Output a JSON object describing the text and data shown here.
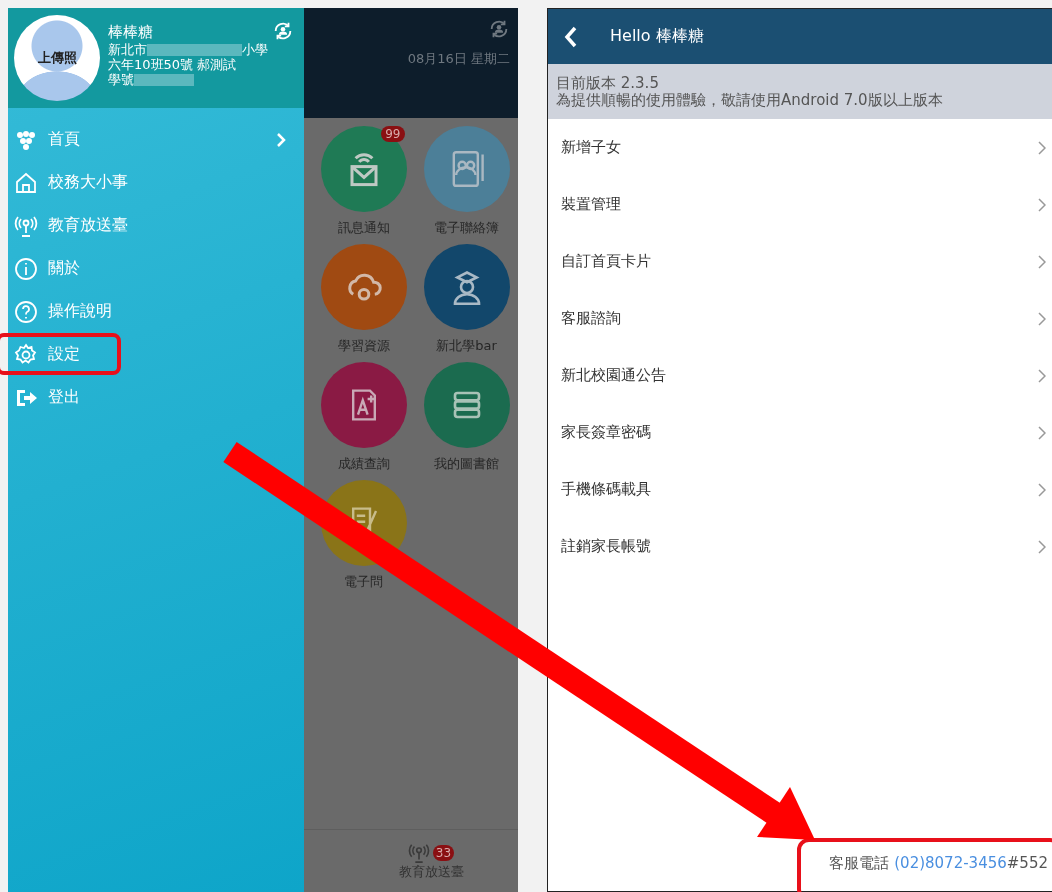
{
  "drawer": {
    "profile": {
      "avatar_text": "上傳照",
      "name": "棒棒糖",
      "school_prefix": "新北市",
      "school_suffix": "小學",
      "class_line": "六年10班50號 郝測試",
      "id_label": "學號"
    },
    "menu": [
      {
        "label": "首頁",
        "has_arrow": true,
        "highlighted": false
      },
      {
        "label": "校務大小事",
        "has_arrow": false,
        "highlighted": false
      },
      {
        "label": "教育放送臺",
        "has_arrow": false,
        "highlighted": false
      },
      {
        "label": "關於",
        "has_arrow": false,
        "highlighted": false
      },
      {
        "label": "操作說明",
        "has_arrow": false,
        "highlighted": false
      },
      {
        "label": "設定",
        "has_arrow": false,
        "highlighted": true
      },
      {
        "label": "登出",
        "has_arrow": false,
        "highlighted": false
      }
    ]
  },
  "home": {
    "date": "08月16日 星期二",
    "apps": [
      {
        "label": "訊息通知",
        "color": "#1f7a55",
        "badge": "99"
      },
      {
        "label": "電子聯絡簿",
        "color": "#4c7f98"
      },
      {
        "label": "學習資源",
        "color": "#a04a12"
      },
      {
        "label": "新北學bar",
        "color": "#12476b"
      },
      {
        "label": "成績查詢",
        "color": "#8a1a44"
      },
      {
        "label": "我的圖書館",
        "color": "#1b6b4f"
      },
      {
        "label": "電子問",
        "color": "#8a7418"
      }
    ],
    "bottom_tab": {
      "label": "教育放送臺",
      "badge": "33"
    }
  },
  "settings": {
    "title": "Hello 棒棒糖",
    "version": "目前版本 2.3.5",
    "notice": "為提供順暢的使用體驗，敬請使用Android 7.0版以上版本",
    "items": [
      "新增子女",
      "裝置管理",
      "自訂首頁卡片",
      "客服諮詢",
      "新北校園通公告",
      "家長簽章密碼",
      "手機條碼載具",
      "註銷家長帳號"
    ],
    "footer": {
      "label": "客服電話",
      "phone": "(02)8072-3456",
      "ext": "#552",
      "highlighted": true
    }
  }
}
